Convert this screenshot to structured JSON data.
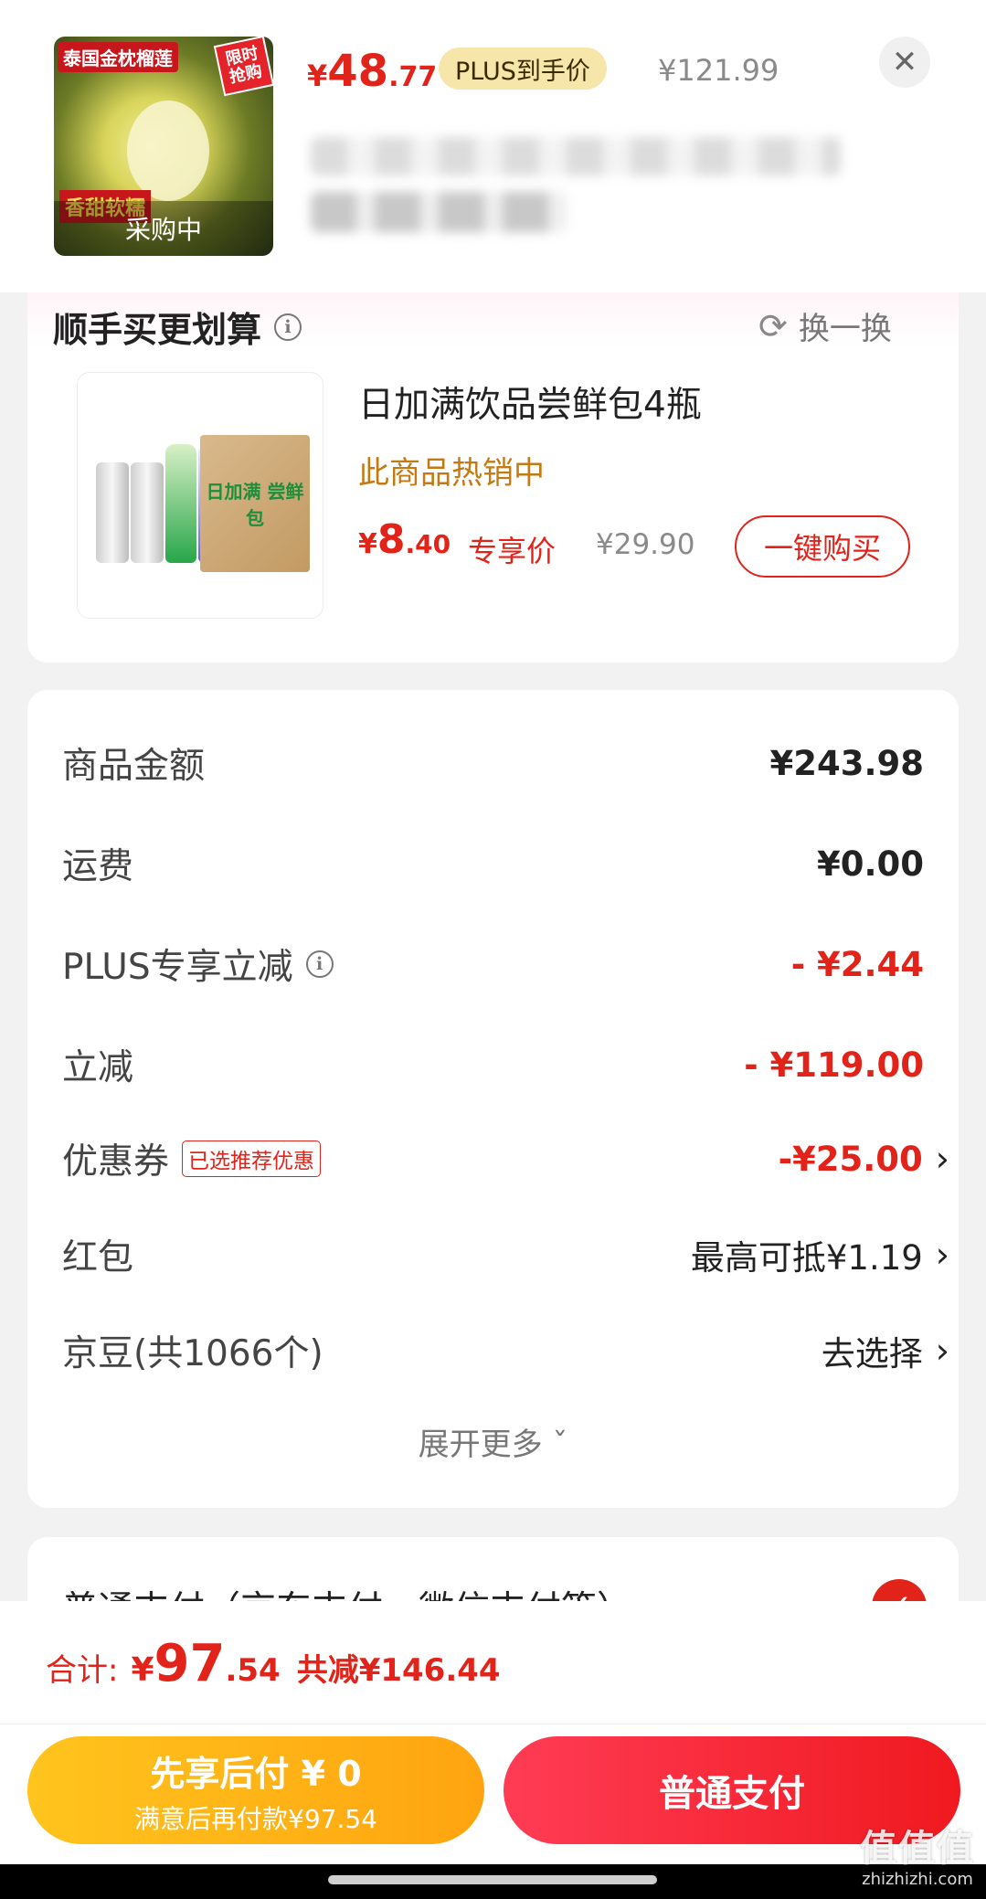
{
  "header": {
    "thumbnail": {
      "tag_top_left": "泰国金枕榴莲",
      "tag_top_right": "限时抢购",
      "tag_bottom_left": "香甜软糯",
      "overlay": "采购中"
    },
    "price": {
      "currency": "¥",
      "integer": "48",
      "decimal": ".77"
    },
    "plus_badge": "PLUS到手价",
    "original_price": "¥121.99",
    "close_icon": "close-icon"
  },
  "upsell": {
    "title": "顺手买更划算",
    "swap_label": "换一换",
    "product": {
      "name": "日加满饮品尝鲜包4瓶",
      "box_label": "日加满 尝鲜包",
      "hot_label": "此商品热销中",
      "price": {
        "currency": "¥",
        "integer": "8",
        "decimal": ".40"
      },
      "exclusive_label": "专享价",
      "original_price": "¥29.90",
      "buy_button": "一键购买"
    }
  },
  "summary": {
    "goods_amount": {
      "label": "商品金额",
      "value": "¥243.98"
    },
    "shipping": {
      "label": "运费",
      "value": "¥0.00"
    },
    "plus_discount": {
      "label": "PLUS专享立减",
      "value": "- ¥2.44"
    },
    "instant_discount": {
      "label": "立减",
      "value": "- ¥119.00"
    },
    "coupon": {
      "label": "优惠券",
      "tag": "已选推荐优惠",
      "value": "-¥25.00"
    },
    "red_packet": {
      "label": "红包",
      "value": "最高可抵¥1.19"
    },
    "jd_beans": {
      "label": "京豆(共1066个)",
      "value": "去选择"
    },
    "expand_label": "展开更多"
  },
  "payment": {
    "method_label": "普通支付（京东支付、微信支付等）"
  },
  "bottom": {
    "total_label": "合计:",
    "total": {
      "currency": "¥",
      "integer": "97",
      "decimal": ".54"
    },
    "saved": "共减¥146.44",
    "pay_later": {
      "title": "先享后付 ¥ 0",
      "subtitle": "满意后再付款¥97.54"
    },
    "pay_button": "普通支付"
  },
  "watermark": {
    "big": "值值值",
    "small": "zhizhizhi.com"
  },
  "colors": {
    "accent_red": "#e2231a",
    "gold": "#c47a10",
    "yellow_button": "#ffb316"
  }
}
